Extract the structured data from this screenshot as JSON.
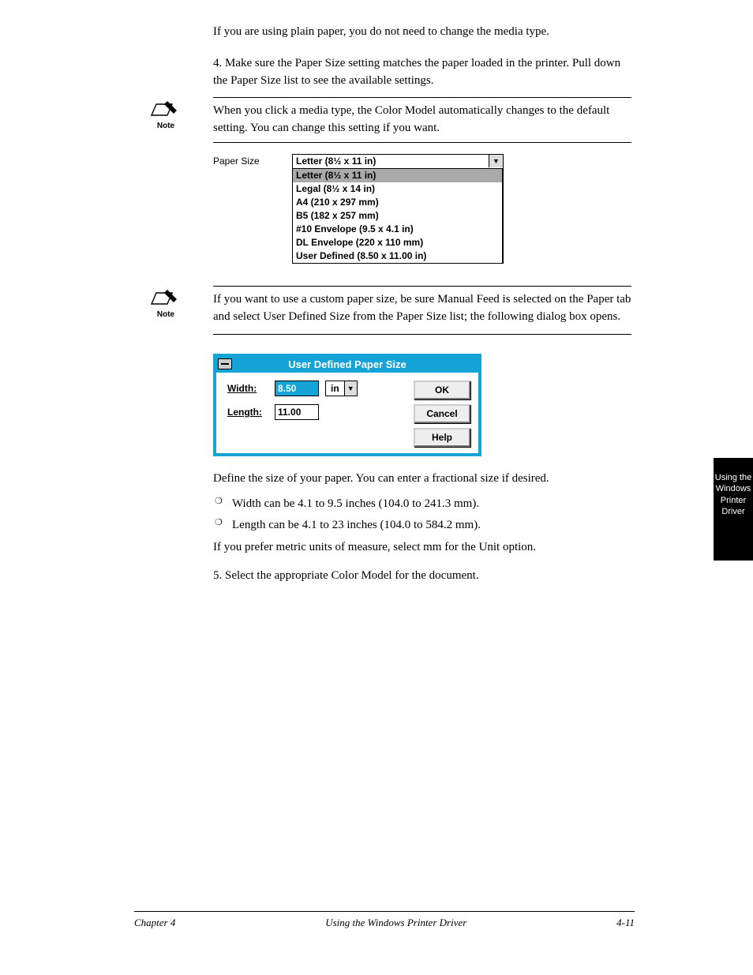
{
  "intro": {
    "p1": "If you are using plain paper, you do not need to change the media type.",
    "p2": "4. Make sure the Paper Size setting matches the paper loaded in the printer. Pull down the Paper Size list to see the available settings."
  },
  "note1": "When you click a media type, the Color Model automatically changes to the default setting. You can change this setting if you want.",
  "paperSize": {
    "label": "Paper Size",
    "current": "Letter (8½ x 11 in)",
    "options": [
      "Letter (8½ x 11 in)",
      "Legal (8½ x 14 in)",
      "A4 (210 x 297 mm)",
      "B5 (182 x 257 mm)",
      "#10 Envelope (9.5 x 4.1 in)",
      "DL Envelope (220 x 110 mm)",
      "User Defined (8.50 x 11.00 in)"
    ]
  },
  "note2": "If you want to use a custom paper size, be sure Manual Feed is selected on the Paper tab and select User Defined Size from the Paper Size list; the following dialog box opens.",
  "dialog": {
    "title": "User Defined Paper Size",
    "width_label": "Width:",
    "length_label": "Length:",
    "width_value": "8.50",
    "length_value": "11.00",
    "unit": "in",
    "ok": "OK",
    "cancel": "Cancel",
    "help": "Help"
  },
  "afterDialog": {
    "lead": "Define the size of your paper. You can enter a fractional size if desired.",
    "b1": "Width can be 4.1 to 9.5 inches (104.0 to 241.3 mm).",
    "b2": "Length can be 4.1 to 23 inches (104.0 to 584.2 mm).",
    "units": "If you prefer metric units of measure, select mm for the Unit option.",
    "p5": "5. Select the appropriate Color Model for the document."
  },
  "sidetab": "Using the Windows Printer Driver",
  "footer": {
    "left": "Chapter 4",
    "center": "Using the Windows Printer Driver",
    "right": "4-11"
  }
}
